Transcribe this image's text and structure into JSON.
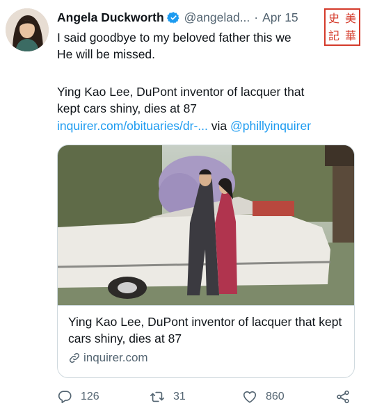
{
  "tweet": {
    "author_name": "Angela Duckworth",
    "handle": "@angelad...",
    "separator": "·",
    "date": "Apr 15",
    "text_line_1": "I said goodbye to my beloved father this we",
    "text_line_2": "He will be missed.",
    "text_line_3": "Ying Kao Lee, DuPont inventor of lacquer that",
    "text_line_4": "kept cars shiny, dies at 87",
    "link_text": "inquirer.com/obituaries/dr-...",
    "via_text": " via ",
    "mention": "@phillyinquirer"
  },
  "stamp": {
    "chars": [
      "史",
      "美",
      "記",
      "華"
    ]
  },
  "card": {
    "title": "Ying Kao Lee, DuPont inventor of lacquer that kept cars shiny, dies at 87",
    "domain": "inquirer.com",
    "icon": "link-icon"
  },
  "actions": {
    "replies": "126",
    "retweets": "31",
    "likes": "860"
  },
  "colors": {
    "link": "#1d9bf0",
    "verified": "#1d9bf0",
    "secondary_text": "#536471",
    "stamp": "#d43a2a"
  }
}
